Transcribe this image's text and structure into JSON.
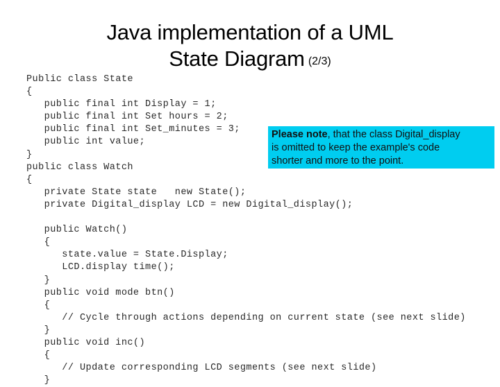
{
  "slide": {
    "background_color": "#ffffff",
    "title": {
      "line1": "Java implementation of a UML",
      "line2": "State Diagram",
      "suffix": "(2/3)"
    },
    "note": {
      "background_color": "#00cdf0",
      "text_color": "#111111",
      "line1_strong": "Please note",
      "line1_rest": ", that the class Digital_display",
      "line2": "is omitted to keep the example's code",
      "line3": "shorter and more to the point."
    },
    "code": {
      "language": "java",
      "lines": [
        "Public class State",
        "{",
        "   public final int Display = 1;",
        "   public final int Set hours = 2;",
        "   public final int Set_minutes = 3;",
        "   public int value;",
        "}",
        "public class Watch",
        "{",
        "   private State state   new State();",
        "   private Digital_display LCD = new Digital_display();",
        "",
        "   public Watch()",
        "   {",
        "      state.value = State.Display;",
        "      LCD.display time();",
        "   }",
        "   public void mode btn()",
        "   {",
        "      // Cycle through actions depending on current state (see next slide)",
        "   }",
        "   public void inc()",
        "   {",
        "      // Update corresponding LCD segments (see next slide)",
        "   }"
      ]
    }
  }
}
